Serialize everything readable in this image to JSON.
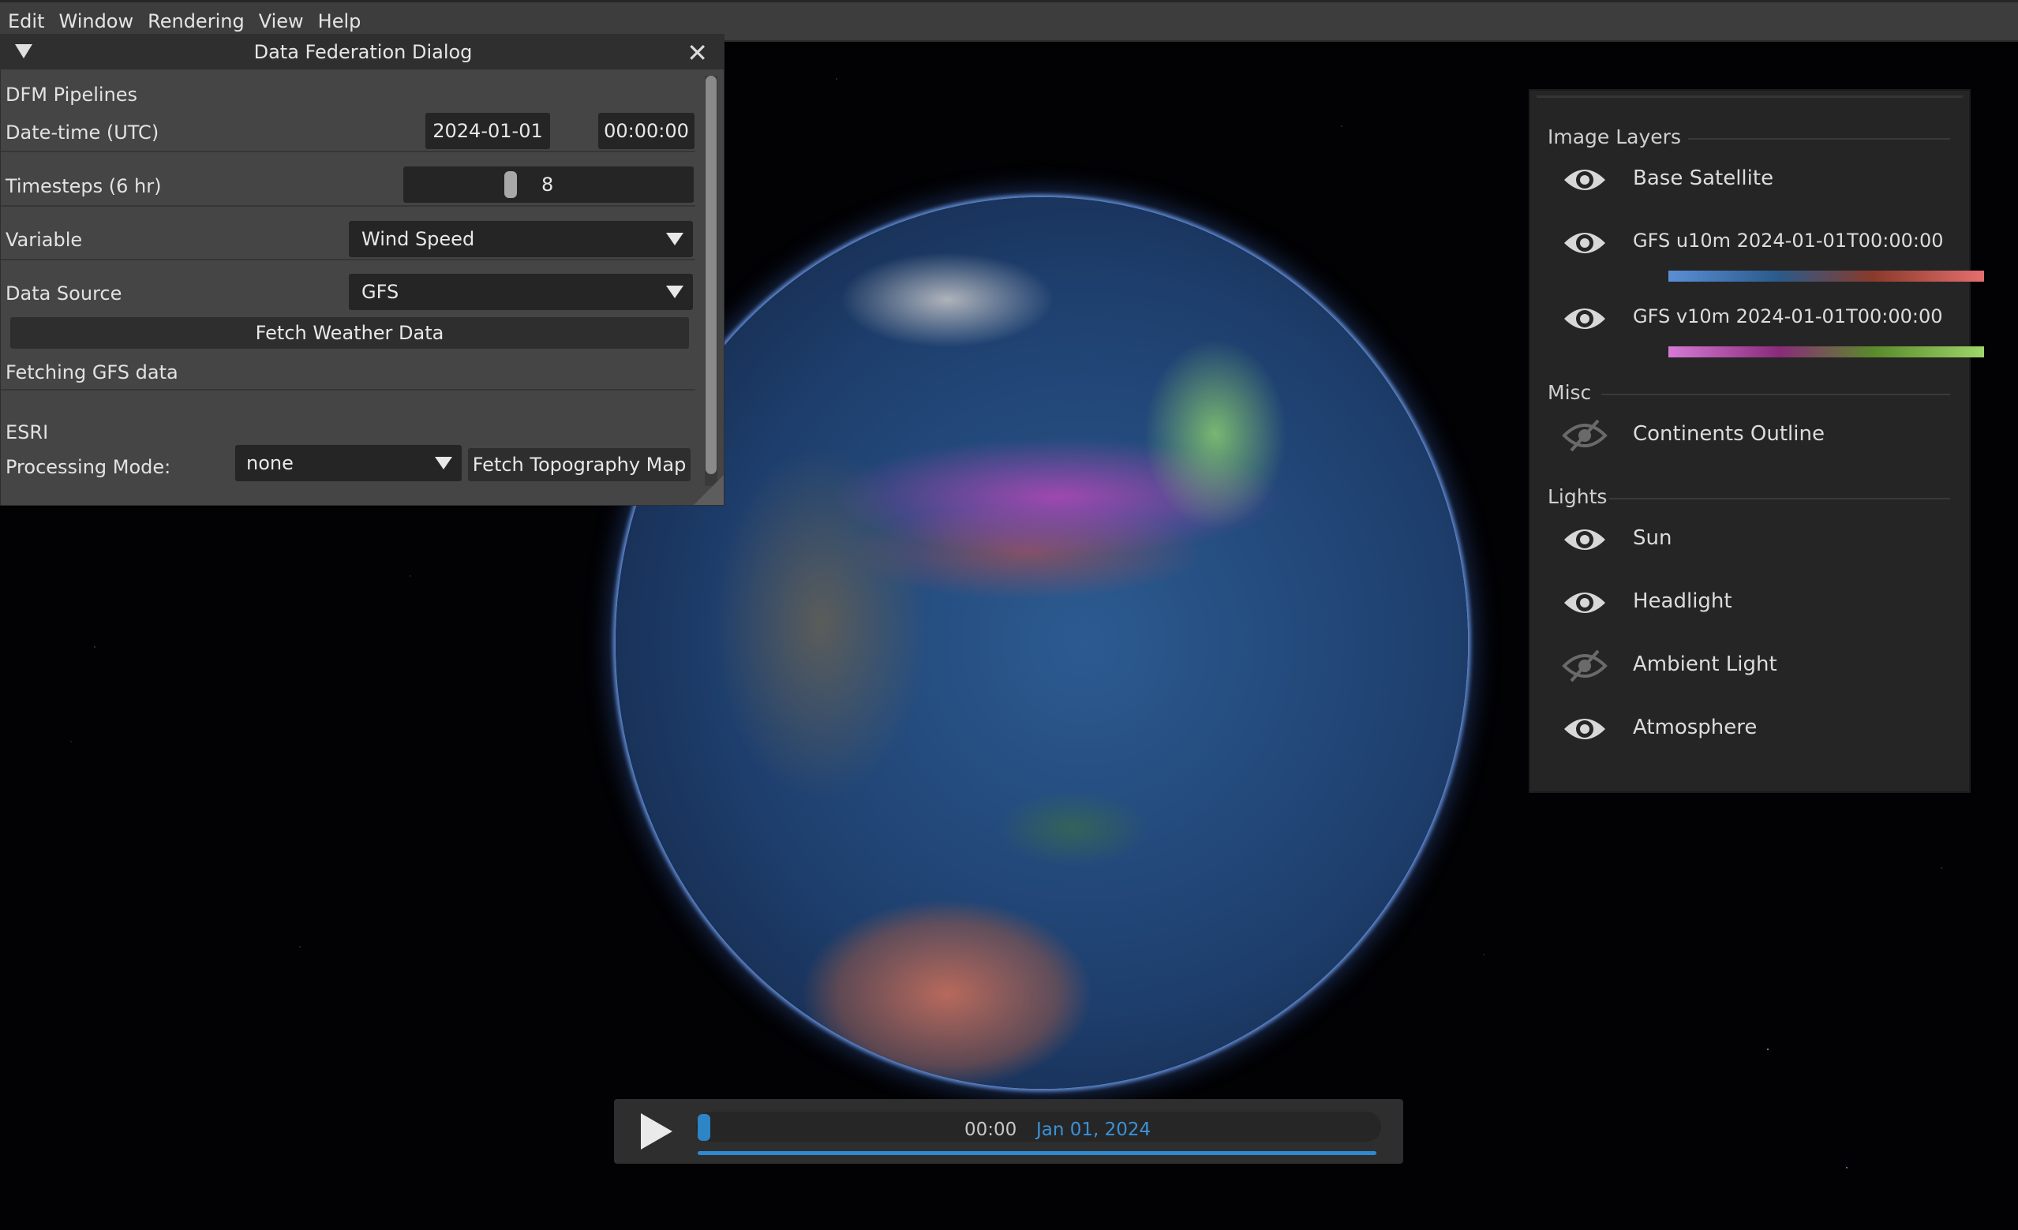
{
  "menu": [
    "Edit",
    "Window",
    "Rendering",
    "View",
    "Help"
  ],
  "dialog": {
    "title": "Data Federation Dialog",
    "dfm_pipelines": "DFM Pipelines",
    "datetime_label": "Date-time (UTC)",
    "date_value": "2024-01-01",
    "time_value": "00:00:00",
    "timesteps_label": "Timesteps (6 hr)",
    "timesteps_value": "8",
    "variable_label": "Variable",
    "variable_value": "Wind Speed",
    "datasource_label": "Data Source",
    "datasource_value": "GFS",
    "fetch_weather": "Fetch Weather Data",
    "status": "Fetching GFS data",
    "esri_label": "ESRI",
    "processing_label": "Processing Mode:",
    "processing_value": "none",
    "fetch_topography": "Fetch Topography Map"
  },
  "layers": {
    "image_layers_title": "Image Layers",
    "image_layers": [
      {
        "name": "Base Satellite",
        "visible": true
      },
      {
        "name": "GFS u10m 2024-01-01T00:00:00",
        "visible": true,
        "ramp": [
          "#5b8fd6",
          "#2a5a8a",
          "#8a3a2a",
          "#e56f6f"
        ]
      },
      {
        "name": "GFS v10m 2024-01-01T00:00:00",
        "visible": true,
        "ramp": [
          "#d67ad6",
          "#8a2a7a",
          "#5a8a2a",
          "#9ed66a"
        ]
      }
    ],
    "misc_title": "Misc",
    "misc": [
      {
        "name": "Continents Outline",
        "visible": false
      }
    ],
    "lights_title": "Lights",
    "lights": [
      {
        "name": "Sun",
        "visible": true
      },
      {
        "name": "Headlight",
        "visible": true
      },
      {
        "name": "Ambient Light",
        "visible": false
      },
      {
        "name": "Atmosphere",
        "visible": true
      }
    ]
  },
  "timeline": {
    "time": "00:00",
    "date": "Jan 01, 2024",
    "progress": 1.0
  },
  "colors": {
    "accent": "#2e8ad0",
    "panel_bg": "#454545",
    "layers_bg": "#252525"
  }
}
